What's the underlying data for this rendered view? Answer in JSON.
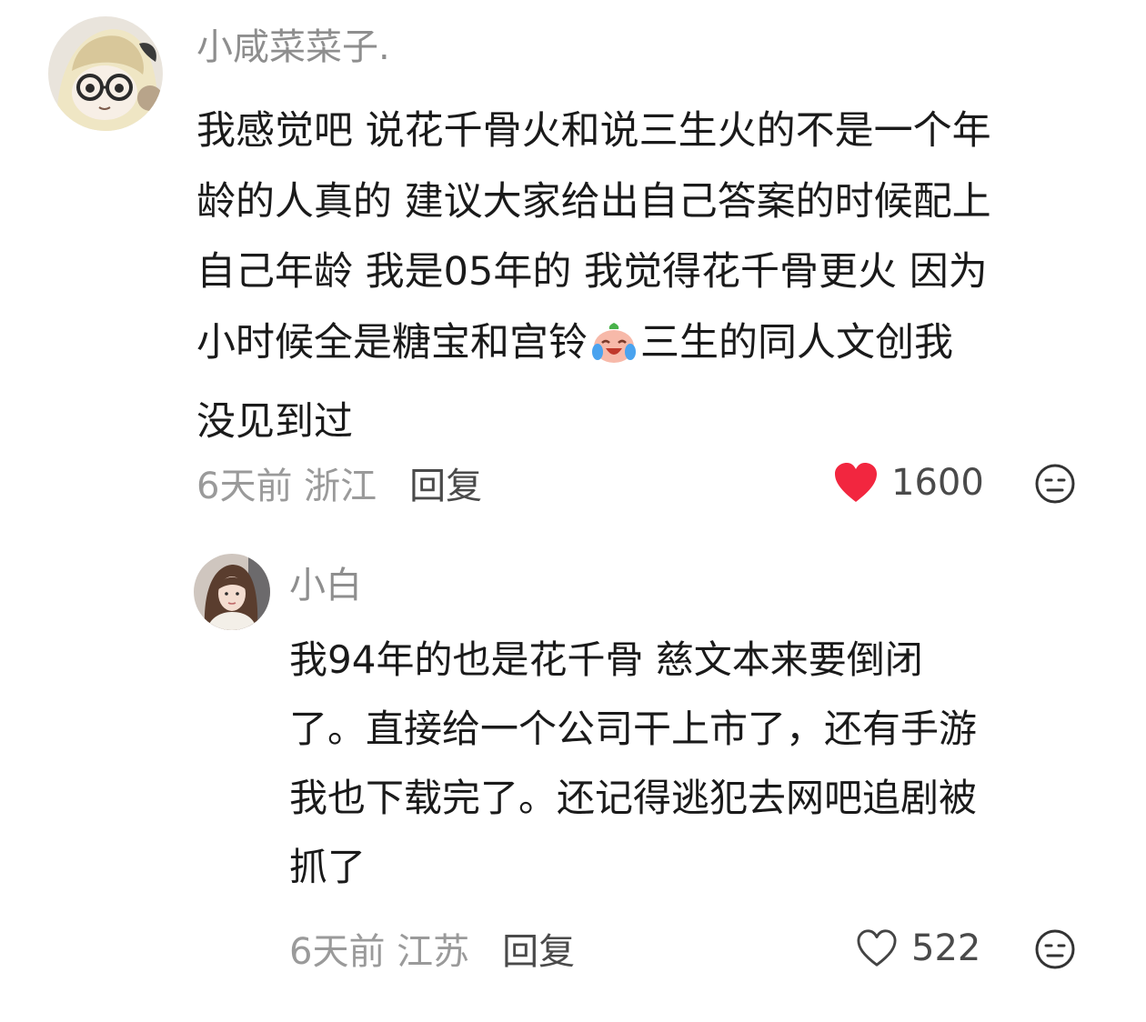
{
  "comments": [
    {
      "username": "小咸菜菜子.",
      "lines": [
        "我感觉吧 说花千骨火和说三生火的不是一个年",
        "龄的人真的 建议大家给出自己答案的时候配上",
        "自己年龄 我是05年的 我觉得花千骨更火 因为",
        "小时候全是糖宝和宫铃",
        "三生的同人文创我",
        "没见到过"
      ],
      "meta": "6天前 浙江",
      "reply_label": "回复",
      "likes": "1600",
      "liked": true,
      "like_color": "#f2263f"
    },
    {
      "username": "小白",
      "lines": [
        "我94年的也是花千骨 慈文本来要倒闭",
        "了。直接给一个公司干上市了，还有手游",
        "我也下载完了。还记得逃犯去网吧追剧被",
        "抓了"
      ],
      "meta": "6天前 江苏",
      "reply_label": "回复",
      "likes": "522",
      "liked": false
    }
  ],
  "icons": {
    "emoji": "laughing-crying-face-emoji",
    "like": "heart-icon",
    "reaction": "expressionless-face-icon"
  }
}
